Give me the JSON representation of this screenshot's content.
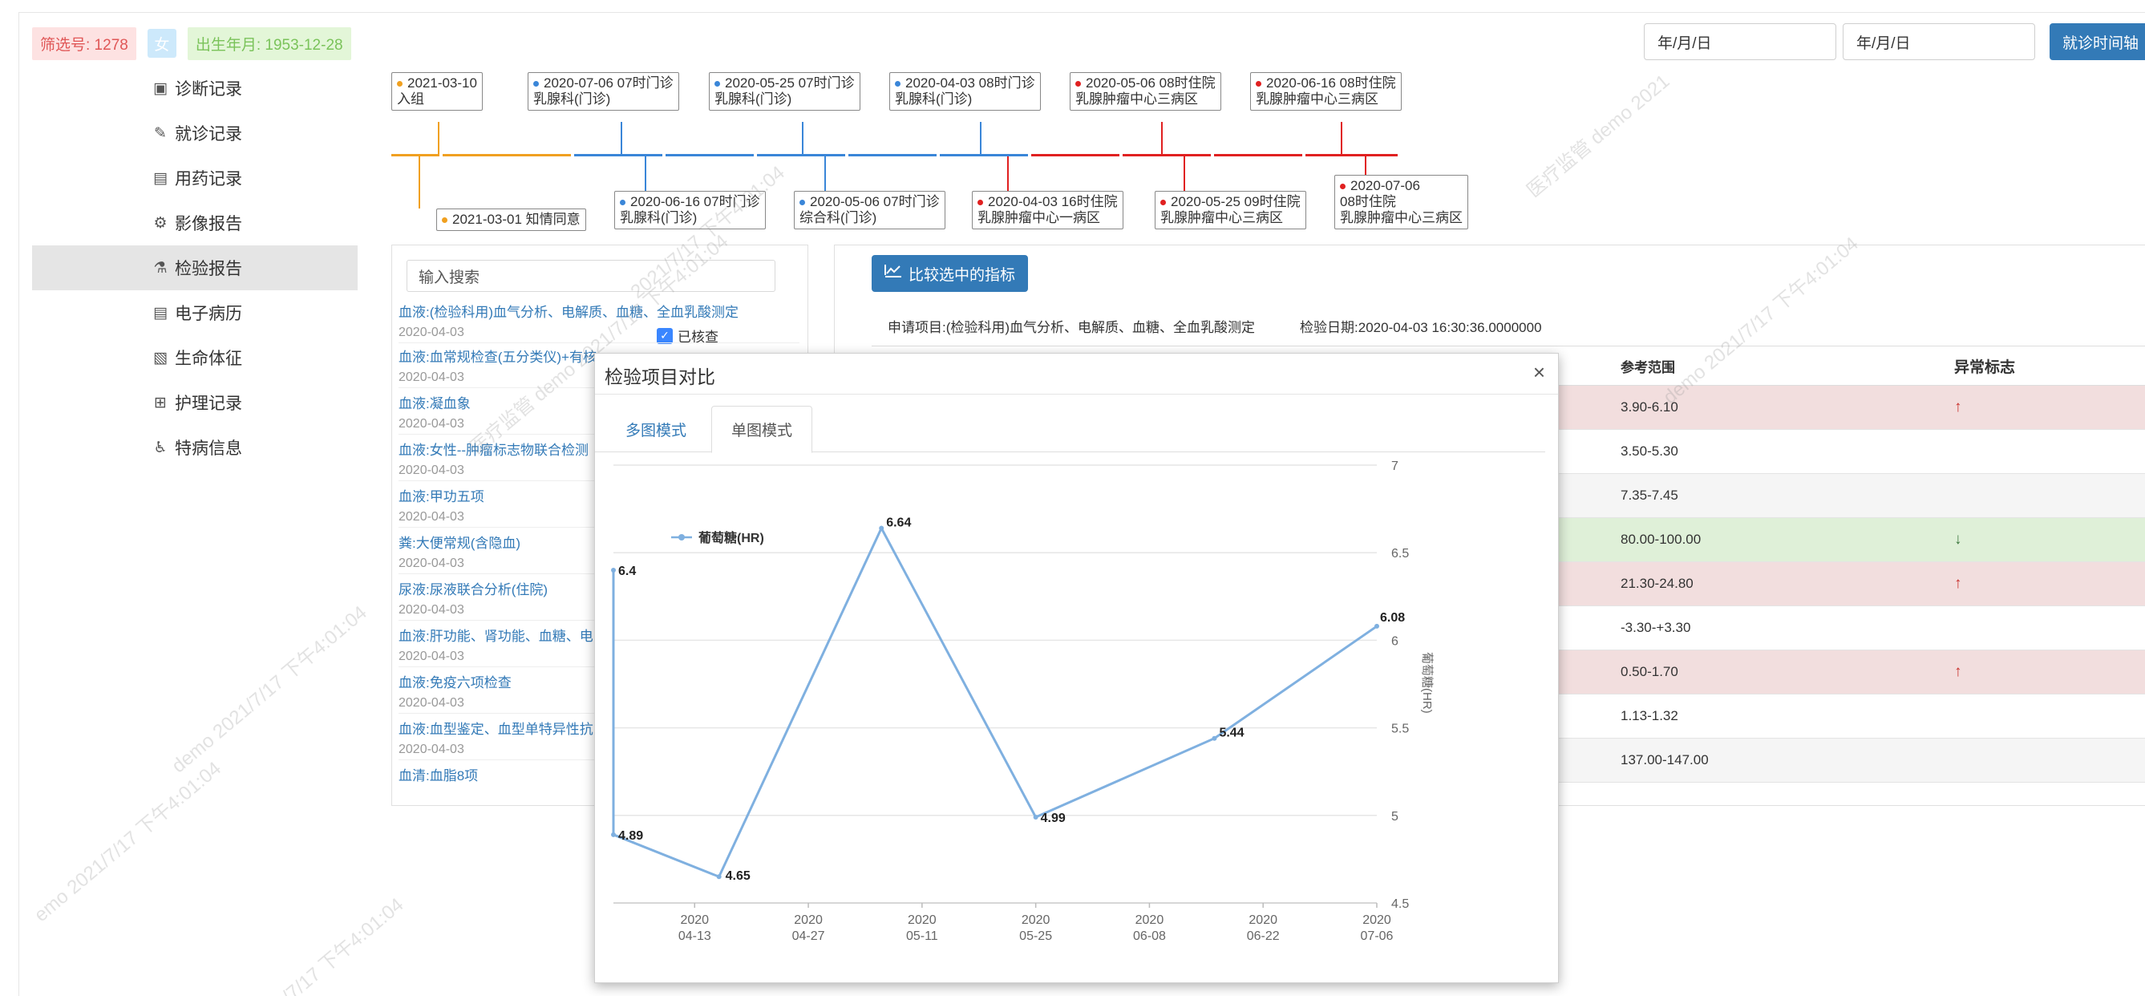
{
  "header": {
    "screen_id_label": "筛选号: 1278",
    "sex": "女",
    "birth_label": "出生年月: 1953-12-28",
    "date_start_placeholder": "年/月/日",
    "date_end_placeholder": "年/月/日",
    "timeline_button": "就诊时间轴"
  },
  "sidebar": {
    "items": [
      {
        "label": "诊断记录",
        "icon": "diagnosis-icon",
        "glyph": "▣"
      },
      {
        "label": "就诊记录",
        "icon": "pencil-icon",
        "glyph": "✎"
      },
      {
        "label": "用药记录",
        "icon": "medication-icon",
        "glyph": "▤"
      },
      {
        "label": "影像报告",
        "icon": "gear-icon",
        "glyph": "⚙"
      },
      {
        "label": "检验报告",
        "icon": "flask-icon",
        "glyph": "⚗"
      },
      {
        "label": "电子病历",
        "icon": "document-icon",
        "glyph": "▤"
      },
      {
        "label": "生命体征",
        "icon": "vitals-icon",
        "glyph": "▧"
      },
      {
        "label": "护理记录",
        "icon": "plus-square-icon",
        "glyph": "⊞"
      },
      {
        "label": "特病信息",
        "icon": "wheelchair-icon",
        "glyph": "♿"
      }
    ],
    "active_index": 4
  },
  "timeline": {
    "top": [
      {
        "line1": "2021-03-10",
        "line2": "入组",
        "color": "#f0a020"
      },
      {
        "line1": "2020-07-06 07时门诊",
        "line2": "乳腺科(门诊)",
        "color": "#3a86d8"
      },
      {
        "line1": "2020-05-25 07时门诊",
        "line2": "乳腺科(门诊)",
        "color": "#3a86d8"
      },
      {
        "line1": "2020-04-03 08时门诊",
        "line2": "乳腺科(门诊)",
        "color": "#3a86d8"
      },
      {
        "line1": "2020-05-06 08时住院",
        "line2": "乳腺肿瘤中心三病区",
        "color": "#e02020"
      },
      {
        "line1": "2020-06-16 08时住院",
        "line2": "乳腺肿瘤中心三病区",
        "color": "#e02020"
      }
    ],
    "bottom": [
      {
        "line1": "2021-03-01 知情同意",
        "line2": "",
        "color": "#f0a020"
      },
      {
        "line1": "2020-06-16 07时门诊",
        "line2": "乳腺科(门诊)",
        "color": "#3a86d8"
      },
      {
        "line1": "2020-05-06 07时门诊",
        "line2": "综合科(门诊)",
        "color": "#3a86d8"
      },
      {
        "line1": "2020-04-03 16时住院",
        "line2": "乳腺肿瘤中心一病区",
        "color": "#e02020"
      },
      {
        "line1": "2020-05-25 09时住院",
        "line2": "乳腺肿瘤中心三病区",
        "color": "#e02020"
      },
      {
        "line1": "2020-07-06",
        "line2": "08时住院",
        "line3": "乳腺肿瘤中心三病区",
        "color": "#e02020"
      }
    ]
  },
  "records": {
    "search_placeholder": "输入搜索",
    "checked_label": "已核查",
    "items": [
      {
        "title": "血液:(检验科用)血气分析、电解质、血糖、全血乳酸测定",
        "date": "2020-04-03"
      },
      {
        "title": "血液:血常规检查(五分类仪)+有核",
        "date": "2020-04-03"
      },
      {
        "title": "血液:凝血象",
        "date": "2020-04-03"
      },
      {
        "title": "血液:女性--肿瘤标志物联合检测",
        "date": "2020-04-03"
      },
      {
        "title": "血液:甲功五项",
        "date": "2020-04-03"
      },
      {
        "title": "粪:大便常规(含隐血)",
        "date": "2020-04-03"
      },
      {
        "title": "尿液:尿液联合分析(住院)",
        "date": "2020-04-03"
      },
      {
        "title": "血液:肝功能、肾功能、血糖、电",
        "date": "2020-04-03"
      },
      {
        "title": "血液:免疫六项检查",
        "date": "2020-04-03"
      },
      {
        "title": "血液:血型鉴定、血型单特异性抗",
        "date": "2020-04-03"
      },
      {
        "title": "血清:血脂8项",
        "date": ""
      }
    ]
  },
  "detail": {
    "compare_button": "比较选中的指标",
    "request_label": "申请项目:(检验科用)血气分析、电解质、血糖、全血乳酸测定",
    "test_date_label": "检验日期:2020-04-03 16:30:36.0000000",
    "col_range": "参考范围",
    "col_flag": "异常标志",
    "rows": [
      {
        "range": "3.90-6.10",
        "flag": "↑",
        "style": "red"
      },
      {
        "range": "3.50-5.30",
        "flag": "",
        "style": "white"
      },
      {
        "range": "7.35-7.45",
        "flag": "",
        "style": "grey"
      },
      {
        "range": "80.00-100.00",
        "flag": "↓",
        "style": "green"
      },
      {
        "range": "21.30-24.80",
        "flag": "↑",
        "style": "red"
      },
      {
        "range": "-3.30-+3.30",
        "flag": "",
        "style": "white"
      },
      {
        "range": "0.50-1.70",
        "flag": "↑",
        "style": "red"
      },
      {
        "range": "1.13-1.32",
        "flag": "",
        "style": "white"
      },
      {
        "range": "137.00-147.00",
        "flag": "",
        "style": "grey"
      }
    ]
  },
  "modal": {
    "title": "检验项目对比",
    "close": "×",
    "tabs": [
      "多图模式",
      "单图模式"
    ],
    "active_tab": 1
  },
  "watermarks": [
    "emo 2021/7/17 下午4:01:04",
    "医疗监管 demo 2021/7/17 下午4:01:04",
    "demo 2021/7/17 下午4:01:04",
    "2021/7/17 下午4:01:04",
    "医疗监管 demo 2021",
    "demo 2021/7/17 下午4:01:04",
    "1/7/17 下午4:01:04"
  ],
  "chart_data": {
    "type": "line",
    "series": [
      {
        "name": "葡萄糖(HR)",
        "color": "#7fb0e0",
        "points": [
          {
            "x": "2020-04-03",
            "y": 6.4
          },
          {
            "x": "2020-04-03",
            "y": 4.89
          },
          {
            "x": "2020-04-16",
            "y": 4.65
          },
          {
            "x": "2020-05-06",
            "y": 6.64
          },
          {
            "x": "2020-05-25",
            "y": 4.99
          },
          {
            "x": "2020-06-16",
            "y": 5.44
          },
          {
            "x": "2020-07-06",
            "y": 6.08
          }
        ]
      }
    ],
    "x_ticks": [
      {
        "date": "2020-04-13",
        "line1": "2020",
        "line2": "04-13"
      },
      {
        "date": "2020-04-27",
        "line1": "2020",
        "line2": "04-27"
      },
      {
        "date": "2020-05-11",
        "line1": "2020",
        "line2": "05-11"
      },
      {
        "date": "2020-05-25",
        "line1": "2020",
        "line2": "05-25"
      },
      {
        "date": "2020-06-08",
        "line1": "2020",
        "line2": "06-08"
      },
      {
        "date": "2020-06-22",
        "line1": "2020",
        "line2": "06-22"
      },
      {
        "date": "2020-07-06",
        "line1": "2020",
        "line2": "07-06"
      }
    ],
    "y_ticks": [
      "4.5",
      "5",
      "5.5",
      "6",
      "6.5",
      "7"
    ],
    "ylim": [
      4.5,
      7
    ],
    "xlim": [
      "2020-04-03",
      "2020-07-06"
    ],
    "ylabel": "葡萄糖(HR)",
    "legend_position": "top-left",
    "grid": true
  }
}
